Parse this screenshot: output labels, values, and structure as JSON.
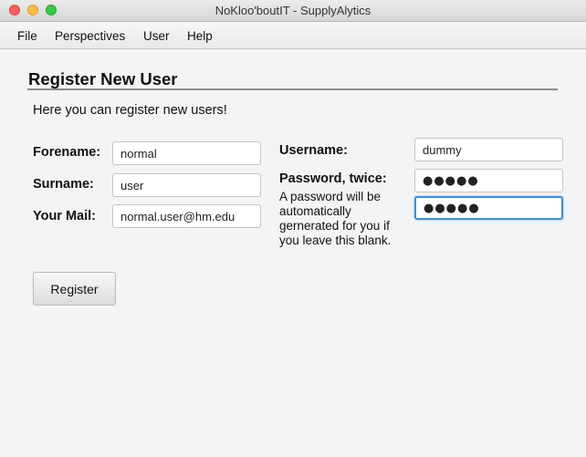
{
  "window": {
    "title": "NoKloo'boutIT - SupplyAlytics"
  },
  "menu": {
    "file": "File",
    "perspectives": "Perspectives",
    "user": "User",
    "help": "Help"
  },
  "page": {
    "heading": "Register New User",
    "intro": "Here you can register new users!"
  },
  "form": {
    "forename_label": "Forename:",
    "forename_value": "normal",
    "surname_label": "Surname:",
    "surname_value": "user",
    "mail_label": "Your Mail:",
    "mail_value": "normal.user@hm.edu",
    "username_label": "Username:",
    "username_value": "dummy",
    "password_label": "Password, twice:",
    "password_value": "●●●●●",
    "password_repeat_value": "●●●●●",
    "password_note": "A password will be automatically gernerated for you if you leave this blank.",
    "register_label": "Register"
  },
  "colors": {
    "focus_ring": "#3a91d6",
    "close": "#fc605c",
    "minimize": "#fdbc40",
    "maximize": "#34c84a"
  }
}
